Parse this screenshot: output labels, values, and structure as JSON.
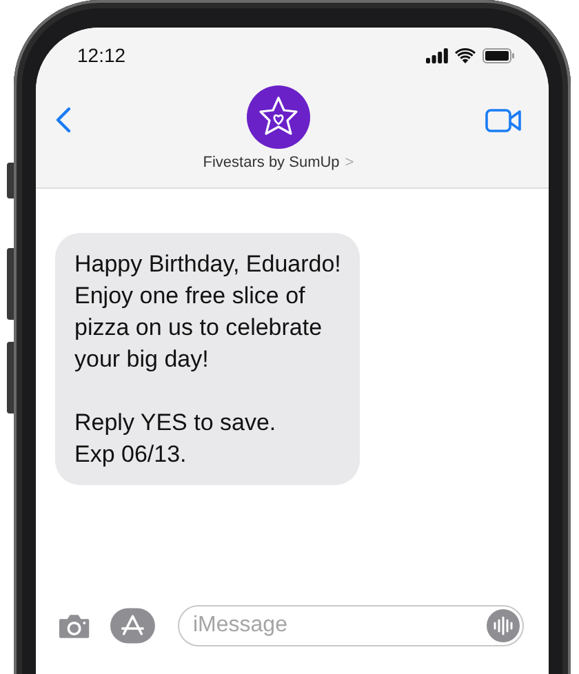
{
  "status_bar": {
    "time": "12:12"
  },
  "header": {
    "contact_name": "Fivestars by SumUp",
    "chevron": ">"
  },
  "messages": [
    {
      "kind": "received",
      "text": "Happy Birthday, Eduardo!\nEnjoy one free slice of\npizza on us to celebrate\nyour big day!\n\nReply YES to save.\nExp 06/13."
    }
  ],
  "composer": {
    "placeholder": "iMessage"
  }
}
